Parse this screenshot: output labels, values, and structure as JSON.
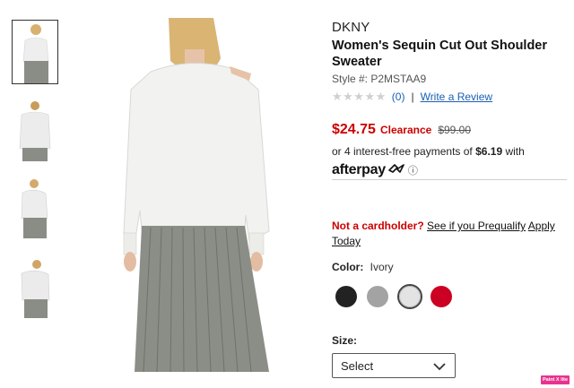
{
  "product": {
    "brand": "DKNY",
    "title": "Women's Sequin Cut Out Shoulder Sweater",
    "style_label": "Style #:",
    "style_number": "P2MSTAA9"
  },
  "rating": {
    "stars": "★★★★★",
    "review_count": "(0)",
    "separator": "|",
    "write_review": "Write a Review"
  },
  "pricing": {
    "sale_price": "$24.75",
    "tag": "Clearance",
    "original_price": "$99.00",
    "installment_prefix": "or 4 interest-free payments of",
    "installment_amount": "$6.19",
    "installment_suffix": "with",
    "afterpay_brand": "afterpay",
    "info_icon": "ⓘ"
  },
  "promo": {
    "question": "Not a cardholder?",
    "prequalify_link": "See if you Prequalify",
    "apply_link": "Apply Today"
  },
  "color": {
    "label": "Color:",
    "selected": "Ivory",
    "swatches": [
      {
        "name": "black",
        "hex": "#222222"
      },
      {
        "name": "grey",
        "hex": "#a3a3a3"
      },
      {
        "name": "ivory",
        "hex": "#e3e3e3"
      },
      {
        "name": "red",
        "hex": "#cc0022"
      }
    ]
  },
  "size": {
    "label": "Size:",
    "selected": "Select"
  },
  "badge": {
    "text": "Paint X lite"
  },
  "colors": {
    "sale_red": "#cc0000",
    "link_blue": "#1a5fb4"
  }
}
